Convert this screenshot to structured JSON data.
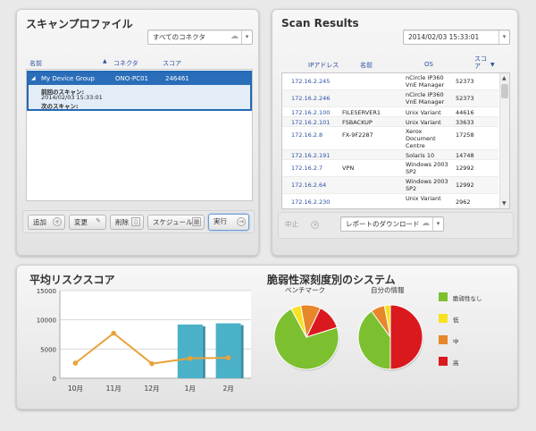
{
  "profile_panel": {
    "title": "スキャンプロファイル",
    "connector_dropdown": "すべてのコネクタ",
    "columns": [
      "名前",
      "コネクタ",
      "スコア"
    ],
    "selected_row": {
      "name": "My Device Group",
      "connector": "ONO-PC01",
      "score": "246461",
      "prev_scan_label": "前回のスキャン:",
      "prev_scan_value": "2014/02/03 15:33:01",
      "next_scan_label": "次のスキャン:"
    },
    "buttons": {
      "add": "追加",
      "change": "変更",
      "delete": "削除",
      "schedule": "スケジュール",
      "run": "実行"
    }
  },
  "results_panel": {
    "title": "Scan Results",
    "date_dropdown": "2014/02/03 15:33:01",
    "columns": [
      "IPアドレス",
      "名前",
      "OS",
      "スコア"
    ],
    "rows": [
      {
        "ip": "172.16.2.245",
        "name": "",
        "os": "nCircle IP360 VnE Manager",
        "score": "52373"
      },
      {
        "ip": "172.16.2.246",
        "name": "",
        "os": "nCircle IP360 VnE Manager",
        "score": "52373"
      },
      {
        "ip": "172.16.2.100",
        "name": "FILESERVER1",
        "os": "Unix Variant",
        "score": "44616"
      },
      {
        "ip": "172.16.2.101",
        "name": "FSBACKUP",
        "os": "Unix Variant",
        "score": "33633"
      },
      {
        "ip": "172.16.2.8",
        "name": "FX-9F2287",
        "os": "Xerox Document Centre",
        "score": "17258"
      },
      {
        "ip": "172.16.2.191",
        "name": "",
        "os": "Solaris 10",
        "score": "14748"
      },
      {
        "ip": "172.16.2.7",
        "name": "VPN",
        "os": "Windows 2003 SP2",
        "score": "12992"
      },
      {
        "ip": "172.16.2.64",
        "name": "",
        "os": "Windows 2003 SP2",
        "score": "12992"
      },
      {
        "ip": "172.16.2.230",
        "name": "",
        "os": "Unix Variant",
        "score": "2962"
      }
    ],
    "stop_button": "中止",
    "download_dropdown": "レポートのダウンロード"
  },
  "bottom_panel": {
    "risk_title": "平均リスクスコア",
    "severity_title": "脆弱性深刻度別のシステム",
    "benchmark_label": "ベンチマーク",
    "own_label": "自分の情報",
    "legend": [
      {
        "label": "脆弱性なし",
        "color": "#7cc030"
      },
      {
        "label": "低",
        "color": "#f7e120"
      },
      {
        "label": "中",
        "color": "#e8862a"
      },
      {
        "label": "高",
        "color": "#d9191e"
      }
    ]
  },
  "chart_data": [
    {
      "type": "bar",
      "title": "平均リスクスコア",
      "categories": [
        "10月",
        "11月",
        "12月",
        "1月",
        "2月"
      ],
      "series": [
        {
          "values": [
            null,
            null,
            null,
            9200,
            9400
          ]
        },
        {
          "values": [
            2600,
            7700,
            2500,
            3400,
            3500
          ]
        }
      ],
      "ylim": [
        0,
        15000
      ],
      "yticks": [
        0,
        5000,
        10000,
        15000
      ],
      "grid": true
    },
    {
      "type": "pie",
      "title": "ベンチマーク",
      "labels": [
        "脆弱性なし",
        "低",
        "中",
        "高"
      ],
      "values": [
        72,
        5,
        10,
        13
      ],
      "colors": [
        "#7cc030",
        "#f7e120",
        "#e8862a",
        "#d9191e"
      ]
    },
    {
      "type": "pie",
      "title": "自分の情報",
      "labels": [
        "脆弱性なし",
        "低",
        "中",
        "高"
      ],
      "values": [
        40,
        3,
        7,
        50
      ],
      "colors": [
        "#7cc030",
        "#f7e120",
        "#e8862a",
        "#d9191e"
      ]
    }
  ]
}
